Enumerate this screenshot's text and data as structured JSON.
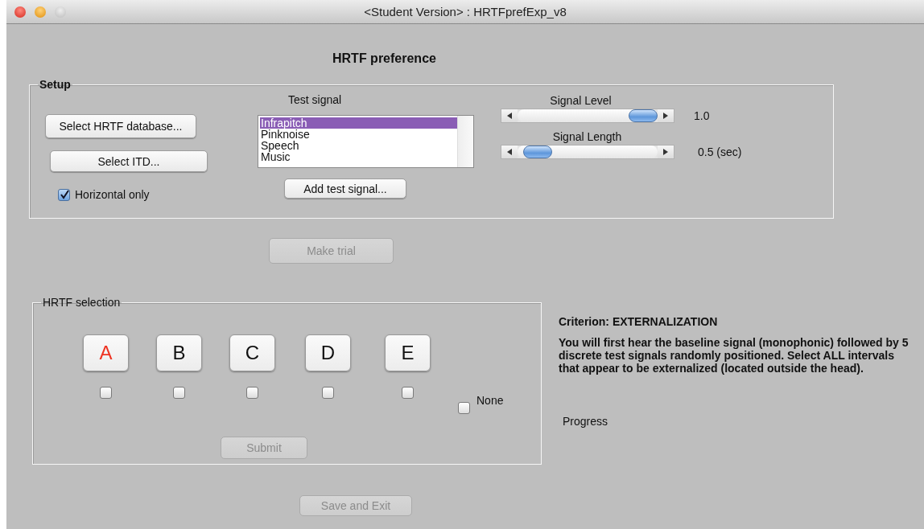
{
  "window": {
    "title": "<Student Version> : HRTFprefExp_v8"
  },
  "heading": "HRTF preference",
  "setup": {
    "title": "Setup",
    "buttons": [
      {
        "label": "Select HRTF database..."
      },
      {
        "label": "Select ITD..."
      }
    ],
    "horizontal_only": {
      "label": "Horizontal only",
      "checked": true
    },
    "test_signal": {
      "label": "Test signal",
      "items": [
        {
          "label": "Infrapitch",
          "selected": true
        },
        {
          "label": "Pinknoise",
          "selected": false
        },
        {
          "label": "Speech",
          "selected": false
        },
        {
          "label": "Music",
          "selected": false
        }
      ],
      "add_button": "Add test signal..."
    },
    "sliders": [
      {
        "label": "Signal Level",
        "level": 1,
        "reading": "1.0"
      },
      {
        "label": "Signal Length",
        "level": 0.05,
        "reading": "0.5 (sec)"
      }
    ]
  },
  "make_trial": {
    "label": "Make trial",
    "disabled": true
  },
  "selection": {
    "title": "HRTF selection",
    "intervals": [
      {
        "label": "A",
        "active": true,
        "checked": false
      },
      {
        "label": "B",
        "active": false,
        "checked": false
      },
      {
        "label": "C",
        "active": false,
        "checked": false
      },
      {
        "label": "D",
        "active": false,
        "checked": false
      },
      {
        "label": "E",
        "active": false,
        "checked": false
      }
    ],
    "none": {
      "label": "None",
      "checked": false
    },
    "submit": {
      "label": "Submit",
      "disabled": true
    }
  },
  "criterion": "Criterion: EXTERNALIZATION",
  "instructions": "You will first hear the baseline signal (monophonic) followed by 5 discrete test signals randomly positioned. Select ALL intervals that appear to be externalized (located outside the head).",
  "progress": "Progress",
  "save_exit": {
    "label": "Save and Exit",
    "disabled": true
  }
}
